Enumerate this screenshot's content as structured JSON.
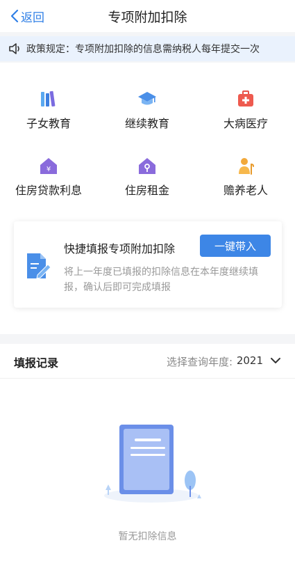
{
  "header": {
    "back_label": "返回",
    "title": "专项附加扣除"
  },
  "notice": {
    "text": "政策规定：专项附加扣除的信息需纳税人每年提交一次"
  },
  "categories": [
    {
      "label": "子女教育",
      "icon": "books-icon"
    },
    {
      "label": "继续教育",
      "icon": "graduation-cap-icon"
    },
    {
      "label": "大病医疗",
      "icon": "medical-kit-icon"
    },
    {
      "label": "住房贷款利息",
      "icon": "house-yuan-icon"
    },
    {
      "label": "住房租金",
      "icon": "house-key-icon"
    },
    {
      "label": "赡养老人",
      "icon": "elderly-icon"
    }
  ],
  "quick_fill": {
    "title": "快捷填报专项附加扣除",
    "button_label": "一键带入",
    "description": "将上一年度已填报的扣除信息在本年度继续填报，确认后即可完成填报"
  },
  "records": {
    "title": "填报记录",
    "year_label": "选择查询年度:",
    "year_value": "2021",
    "empty_text": "暂无扣除信息"
  },
  "colors": {
    "accent": "#3d86e6",
    "notice_bg": "#eaf2fd"
  }
}
